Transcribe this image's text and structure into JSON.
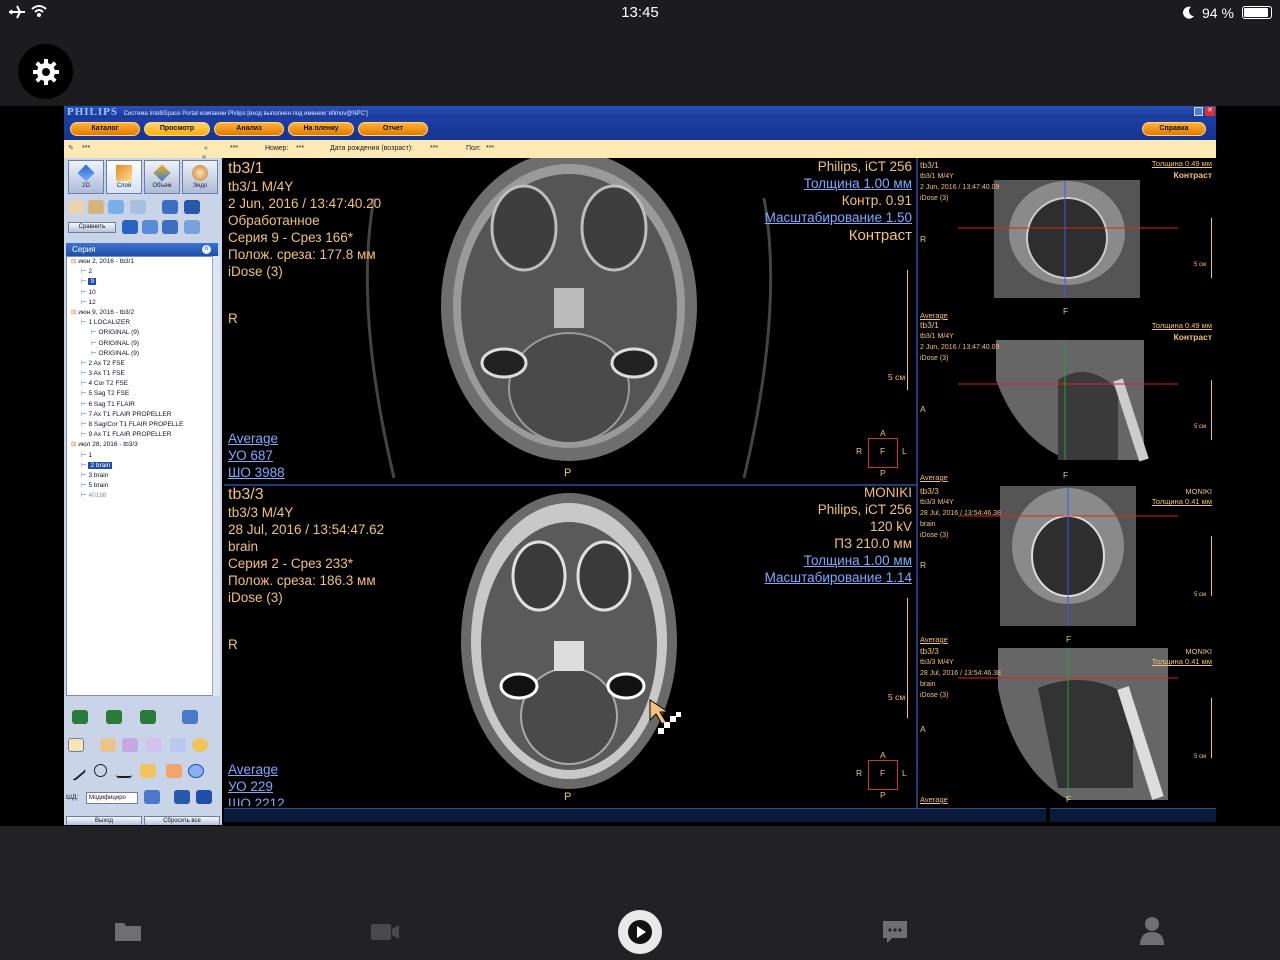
{
  "status": {
    "time": "13:45",
    "battery": "94 %"
  },
  "app": {
    "title_logo": "PHILIPS",
    "title_text": "Система IntelliSpace Portal компании Philips [вход выполнен под именем 'efimov@NPC']",
    "nav": [
      "Каталог",
      "Просмотр",
      "Анализ",
      "На пленку",
      "Отчет"
    ],
    "help": "Справка",
    "info": {
      "field1": "***",
      "field2": "***",
      "number_label": "Номер:",
      "number_value": "***",
      "dob_label": "Дата рождения (возраст):",
      "dob_value": "***",
      "sex_label": "Пол:",
      "sex_value": "***"
    }
  },
  "left": {
    "tabs": [
      "2D",
      "Слой",
      "Объем",
      "Эндо"
    ],
    "compare_label": "Сравнить",
    "series_title": "Серия",
    "tree": [
      {
        "text": "июн 2, 2016 - tb3/1",
        "level": 0
      },
      {
        "text": "2",
        "level": 1
      },
      {
        "text": "9",
        "level": 1,
        "selected": true
      },
      {
        "text": "10",
        "level": 1
      },
      {
        "text": "12",
        "level": 1
      },
      {
        "text": "июн 9, 2016 - tb3/2",
        "level": 0
      },
      {
        "text": "1  LOCALIZER",
        "level": 1
      },
      {
        "text": "ORIGINAL (9)",
        "level": 2
      },
      {
        "text": "ORIGINAL (9)",
        "level": 2
      },
      {
        "text": "ORIGINAL (9)",
        "level": 2
      },
      {
        "text": "2  Ax T2 FSE",
        "level": 1
      },
      {
        "text": "3  Ax T1 FSE",
        "level": 1
      },
      {
        "text": "4  Cor T2 FSE",
        "level": 1
      },
      {
        "text": "5  Sag T2 FSE",
        "level": 1
      },
      {
        "text": "6  Sag T1 FLAIR",
        "level": 1
      },
      {
        "text": "7  Ax T1 FLAIR PROPELLER",
        "level": 1
      },
      {
        "text": "8  Sag/Cor T1 FLAIR PROPELLE",
        "level": 1
      },
      {
        "text": "9  Ax T1 FLAIR PROPELLER",
        "level": 1
      },
      {
        "text": "июл 28, 2016 - tb3/3",
        "level": 0
      },
      {
        "text": "1",
        "level": 1
      },
      {
        "text": "2  brain",
        "level": 1,
        "selected": true
      },
      {
        "text": "3  brain",
        "level": 1
      },
      {
        "text": "5  brain",
        "level": 1
      },
      {
        "text": "40188",
        "level": 1,
        "dim": true
      }
    ],
    "wl_label": "ШД:",
    "wl_select": "Модифициро",
    "exit_label": "Выход",
    "reset_label": "Сбросить все"
  },
  "viewport_top": {
    "title": "tb3/1",
    "patient": "tb3/1 M/4Y",
    "date": "2 Jun, 2016 / 13:47:40.20",
    "status": "Обработанное",
    "series": "Серия 9 - Срез 166*",
    "position": "Полож. среза: 177.8 мм",
    "idose": "iDose (3)",
    "scanner": "Philips, iCT 256",
    "thickness": "Толщина 1.00 мм",
    "contrast_val": "Контр. 0.91",
    "zoom": "Масштабирование 1.50",
    "contrast": "Контраст",
    "orient_left": "R",
    "orient_bottom": "P",
    "scale": "5 см",
    "avg": "Average",
    "wl1": "УО   687",
    "wl2": "ШО  3988",
    "cube": {
      "top": "A",
      "left": "R",
      "center": "F",
      "right": "L",
      "bottom": "P"
    }
  },
  "viewport_bottom": {
    "title": "tb3/3",
    "patient": "tb3/3 M/4Y",
    "date": "28 Jul, 2016 / 13:54:47.62",
    "status": "brain",
    "series": "Серия 2 - Срез 233*",
    "position": "Полож. среза: 186.3 мм",
    "idose": "iDose (3)",
    "institution": "MONIKI",
    "scanner": "Philips, iCT 256",
    "kv": "120 kV",
    "fov": "ПЗ 210.0 мм",
    "thickness": "Толщина 1.00 мм",
    "zoom": "Масштабирование 1.14",
    "orient_left": "R",
    "orient_bottom": "P",
    "scale": "5 см",
    "avg": "Average",
    "wl1": "УО   229",
    "wl2": "ШО  2212",
    "cube": {
      "top": "A",
      "left": "R",
      "center": "F",
      "right": "L",
      "bottom": "P"
    }
  },
  "thumbs": [
    {
      "title": "tb3/1",
      "l1": "tb3/1 M/4Y",
      "l2": "2 Jun, 2016 / 13:47:40.09",
      "l3": "iDose (3)",
      "thick": "Толщина 0.49 мм",
      "contrast": "Контраст",
      "side": "R",
      "bottom": "F",
      "scale": "5 см",
      "avg": "Average"
    },
    {
      "title": "tb3/1",
      "l1": "tb3/1 M/4Y",
      "l2": "2 Jun, 2016 / 13:47:40.09",
      "l3": "iDose (3)",
      "thick": "Толщина 0.49 мм",
      "contrast": "Контраст",
      "side": "A",
      "bottom": "F",
      "scale": "5 см",
      "avg": "Average"
    },
    {
      "title": "tb3/3",
      "l1": "tb3/3 M/4Y",
      "l2": "28 Jul, 2016 / 13:54:46.38",
      "l3": "brain",
      "l4": "iDose (3)",
      "inst": "MONIKI",
      "thick": "Толщина 0.41 мм",
      "side": "R",
      "bottom": "F",
      "scale": "5 см",
      "avg": "Average"
    },
    {
      "title": "tb3/3",
      "l1": "tb3/3 M/4Y",
      "l2": "28 Jul, 2016 / 13:54:46.38",
      "l3": "brain",
      "l4": "iDose (3)",
      "inst": "MONIKI",
      "thick": "Толщина 0.41 мм",
      "side": "A",
      "bottom": "F",
      "scale": "5 см",
      "avg": "Average"
    }
  ]
}
